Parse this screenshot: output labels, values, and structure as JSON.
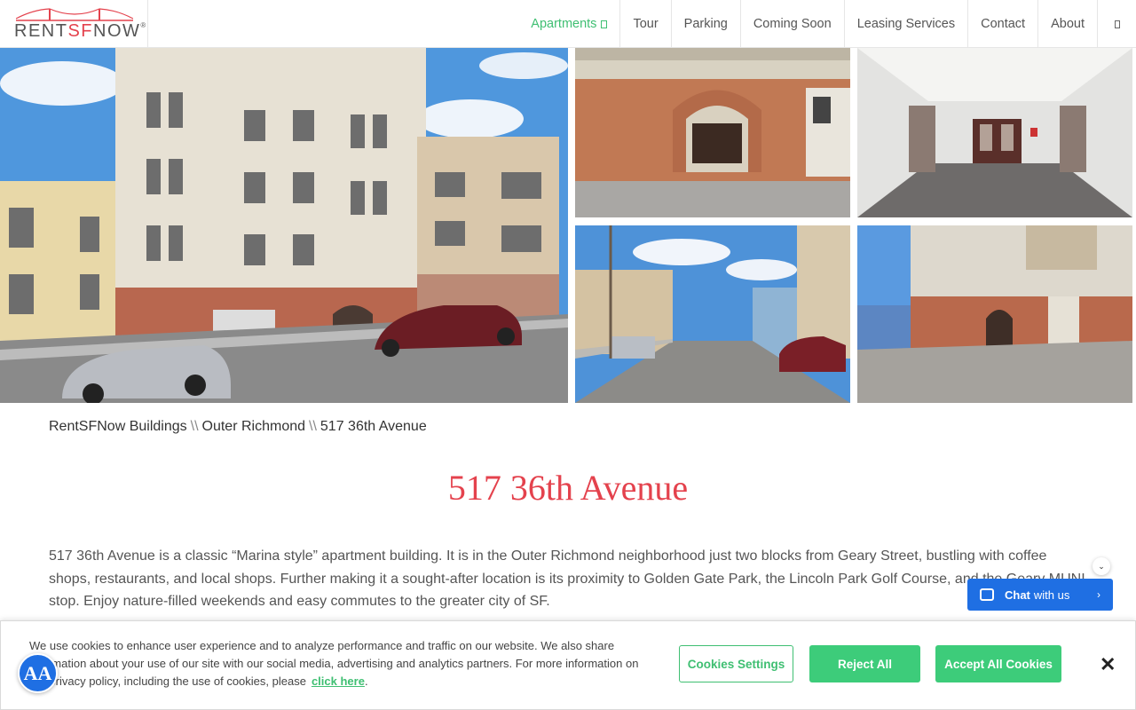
{
  "header": {
    "logo_prefix": "RENT",
    "logo_sf": "SF",
    "logo_suffix": "NOW",
    "logo_reg": "®",
    "nav": [
      {
        "label": "Apartments",
        "active": true
      },
      {
        "label": "Tour"
      },
      {
        "label": "Parking"
      },
      {
        "label": "Coming Soon"
      },
      {
        "label": "Leasing Services"
      },
      {
        "label": "Contact"
      },
      {
        "label": "About"
      }
    ]
  },
  "breadcrumb": {
    "items": [
      "RentSFNow Buildings",
      "Outer Richmond",
      "517 36th Avenue"
    ],
    "separator": "\\\\"
  },
  "page": {
    "title": "517 36th Avenue",
    "description": "517 36th Avenue is a classic “Marina style” apartment building. It is in the Outer Richmond neighborhood just two blocks from Geary Street, bustling with coffee shops, restaurants, and local shops. Further making it a sought-after location is its proximity to Golden Gate Park, the Lincoln Park Golf Course, and the Geary MUNI stop. Enjoy nature-filled weekends and easy commutes to the greater city of SF."
  },
  "chat": {
    "bold": "Chat",
    "rest": "with us",
    "arrow": "›",
    "toggle": "⌄"
  },
  "cookie": {
    "text": "We use cookies to enhance user experience and to analyze performance and traffic on our website. We also share information about your use of our site with our social media, advertising and analytics partners. For more information on our privacy policy, including the use of cookies, please",
    "link": "click here",
    "link_suffix": ".",
    "settings": "Cookies Settings",
    "reject": "Reject All",
    "accept": "Accept All Cookies",
    "close": "✕"
  },
  "accessibility": {
    "label": "AA"
  },
  "colors": {
    "accent": "#3fbf72",
    "title": "#e4424d",
    "chat": "#1f6fe3"
  }
}
